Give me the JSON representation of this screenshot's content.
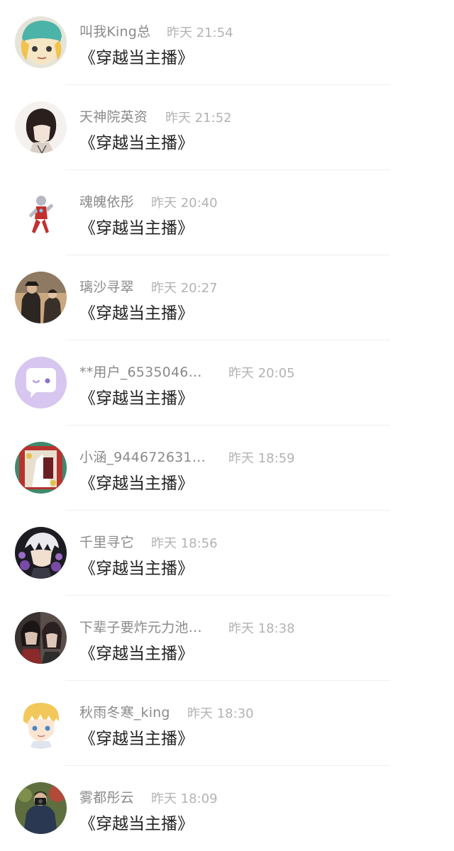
{
  "comments": [
    {
      "name": "叫我King总",
      "time": "昨天 21:54",
      "message": "《穿越当主播》",
      "avatar": "anime-boy-cap"
    },
    {
      "name": "天神院英资",
      "time": "昨天 21:52",
      "message": "《穿越当主播》",
      "avatar": "sketch-dark-hair"
    },
    {
      "name": "魂魄依彤",
      "time": "昨天 20:40",
      "message": "《穿越当主播》",
      "avatar": "ultraman-figure"
    },
    {
      "name": "璃沙寻翠",
      "time": "昨天 20:27",
      "message": "《穿越当主播》",
      "avatar": "couple-photo"
    },
    {
      "name": "**用户_6535046…",
      "time": "昨天 20:05",
      "message": "《穿越当主播》",
      "avatar": "default-chat-bubble"
    },
    {
      "name": "小涵_944672631…",
      "time": "昨天 18:59",
      "message": "《穿越当主播》",
      "avatar": "festive-card"
    },
    {
      "name": "千里寻它",
      "time": "昨天 18:56",
      "message": "《穿越当主播》",
      "avatar": "anime-white-hair"
    },
    {
      "name": "下辈子要炸元力池…",
      "time": "昨天 18:38",
      "message": "《穿越当主播》",
      "avatar": "dark-anime-pair"
    },
    {
      "name": "秋雨冬寒_king",
      "time": "昨天 18:30",
      "message": "《穿越当主播》",
      "avatar": "anime-blonde-boy"
    },
    {
      "name": "雾都彤云",
      "time": "昨天 18:09",
      "message": "《穿越当主播》",
      "avatar": "photographer-photo"
    }
  ]
}
